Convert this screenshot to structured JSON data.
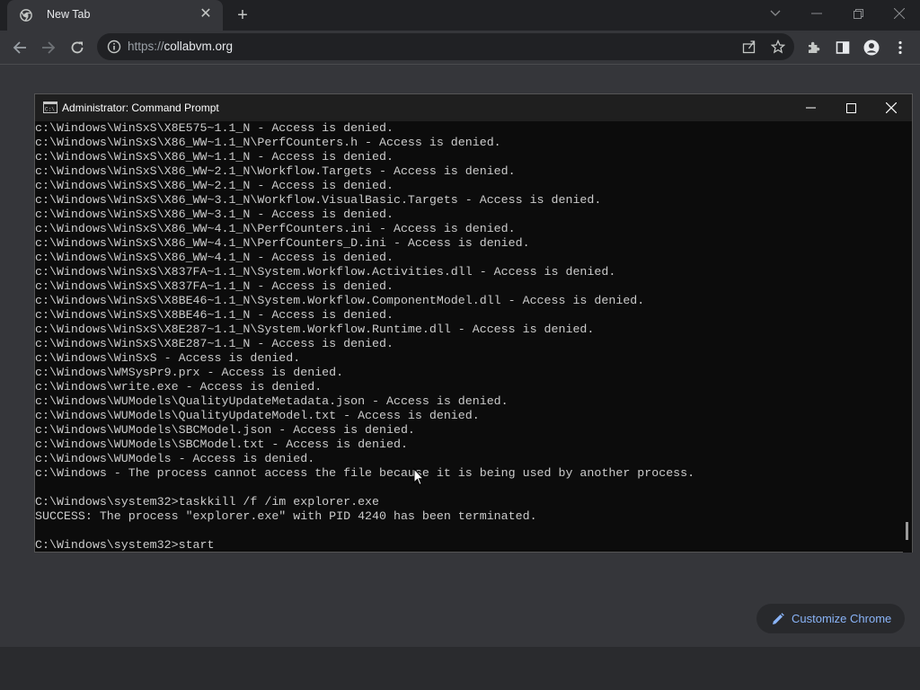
{
  "browser": {
    "tab_title": "New Tab",
    "url_scheme": "https://",
    "url_host": "collabvm.org",
    "customize_label": "Customize Chrome"
  },
  "cmd": {
    "title": "Administrator: Command Prompt",
    "lines": [
      "c:\\Windows\\WinSxS\\X8E575~1.1_N - Access is denied.",
      "c:\\Windows\\WinSxS\\X86_WW~1.1_N\\PerfCounters.h - Access is denied.",
      "c:\\Windows\\WinSxS\\X86_WW~1.1_N - Access is denied.",
      "c:\\Windows\\WinSxS\\X86_WW~2.1_N\\Workflow.Targets - Access is denied.",
      "c:\\Windows\\WinSxS\\X86_WW~2.1_N - Access is denied.",
      "c:\\Windows\\WinSxS\\X86_WW~3.1_N\\Workflow.VisualBasic.Targets - Access is denied.",
      "c:\\Windows\\WinSxS\\X86_WW~3.1_N - Access is denied.",
      "c:\\Windows\\WinSxS\\X86_WW~4.1_N\\PerfCounters.ini - Access is denied.",
      "c:\\Windows\\WinSxS\\X86_WW~4.1_N\\PerfCounters_D.ini - Access is denied.",
      "c:\\Windows\\WinSxS\\X86_WW~4.1_N - Access is denied.",
      "c:\\Windows\\WinSxS\\X837FA~1.1_N\\System.Workflow.Activities.dll - Access is denied.",
      "c:\\Windows\\WinSxS\\X837FA~1.1_N - Access is denied.",
      "c:\\Windows\\WinSxS\\X8BE46~1.1_N\\System.Workflow.ComponentModel.dll - Access is denied.",
      "c:\\Windows\\WinSxS\\X8BE46~1.1_N - Access is denied.",
      "c:\\Windows\\WinSxS\\X8E287~1.1_N\\System.Workflow.Runtime.dll - Access is denied.",
      "c:\\Windows\\WinSxS\\X8E287~1.1_N - Access is denied.",
      "c:\\Windows\\WinSxS - Access is denied.",
      "c:\\Windows\\WMSysPr9.prx - Access is denied.",
      "c:\\Windows\\write.exe - Access is denied.",
      "c:\\Windows\\WUModels\\QualityUpdateMetadata.json - Access is denied.",
      "c:\\Windows\\WUModels\\QualityUpdateModel.txt - Access is denied.",
      "c:\\Windows\\WUModels\\SBCModel.json - Access is denied.",
      "c:\\Windows\\WUModels\\SBCModel.txt - Access is denied.",
      "c:\\Windows\\WUModels - Access is denied.",
      "c:\\Windows - The process cannot access the file because it is being used by another process.",
      "",
      "C:\\Windows\\system32>taskkill /f /im explorer.exe",
      "SUCCESS: The process \"explorer.exe\" with PID 4240 has been terminated.",
      "",
      "C:\\Windows\\system32>start"
    ]
  }
}
